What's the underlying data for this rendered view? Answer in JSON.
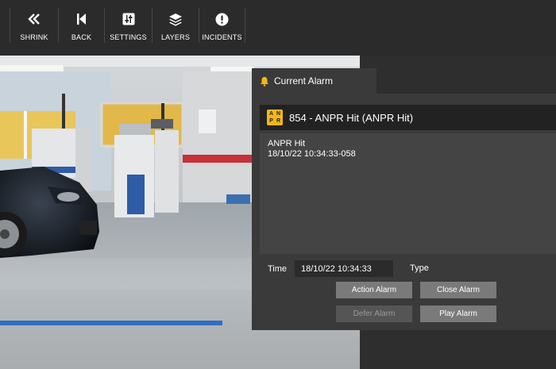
{
  "toolbar": {
    "buttons": [
      {
        "label": "SHRINK",
        "icon": "double-chevron-left-icon"
      },
      {
        "label": "BACK",
        "icon": "skip-back-icon"
      },
      {
        "label": "SETTINGS",
        "icon": "sliders-icon"
      },
      {
        "label": "LAYERS",
        "icon": "layers-icon"
      },
      {
        "label": "INCIDENTS",
        "icon": "alert-circle-icon"
      }
    ]
  },
  "alarm_panel": {
    "tab_title": "Current Alarm",
    "badge_text": [
      "A",
      "N",
      "P",
      "R"
    ],
    "alarm_title": "854 - ANPR Hit (ANPR Hit)",
    "details": [
      "ANPR Hit",
      "18/10/22 10:34:33-058"
    ],
    "time_label": "Time",
    "time_value": "18/10/22 10:34:33",
    "type_label": "Type",
    "buttons": {
      "action": "Action Alarm",
      "close": "Close Alarm",
      "defer": "Defer Alarm",
      "play": "Play Alarm"
    }
  },
  "colors": {
    "toolbar_bg": "#2b2b2b",
    "panel_bg": "#3a3a3a",
    "header_bg": "#222222",
    "badge": "#f3b71c",
    "button": "#7a7a7a"
  }
}
